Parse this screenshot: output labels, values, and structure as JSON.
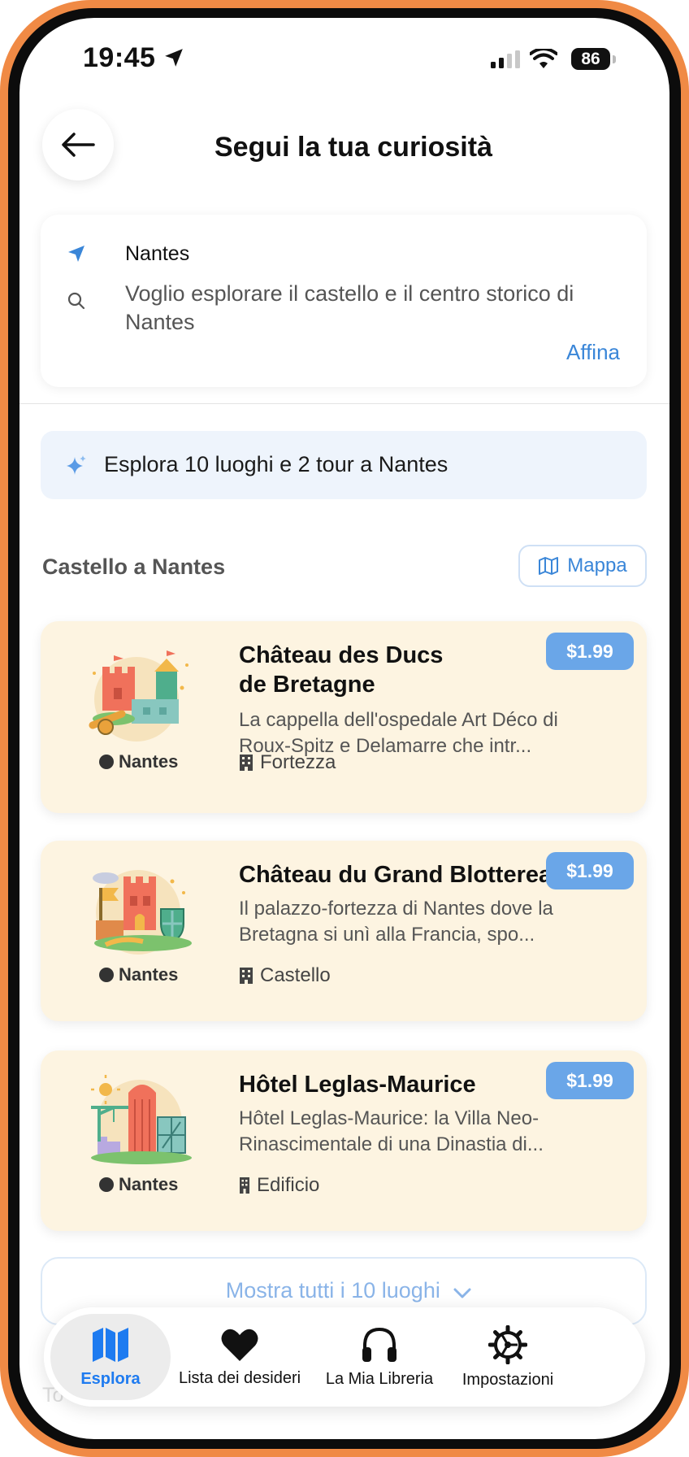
{
  "status_bar": {
    "time": "19:45",
    "battery": "86"
  },
  "header": {
    "title": "Segui la tua curiosità"
  },
  "search": {
    "location": "Nantes",
    "query": "Voglio esplorare il castello e il centro storico di Nantes",
    "refine_label": "Affina"
  },
  "banner": {
    "text": "Esplora 10 luoghi e 2 tour a Nantes"
  },
  "section": {
    "title": "Castello a Nantes",
    "map_label": "Mappa"
  },
  "places": [
    {
      "title": "Château des Ducs\nde Bretagne",
      "description": "La cappella dell'ospedale Art Déco di Roux-Spitz e Delamarre che intr...",
      "category": "Fortezza",
      "city": "Nantes",
      "price": "$1.99"
    },
    {
      "title": "Château du Grand Blottereau",
      "description": "Il palazzo-fortezza di Nantes dove la Bretagna si unì alla Francia, spo...",
      "category": "Castello",
      "city": "Nantes",
      "price": "$1.99"
    },
    {
      "title": "Hôtel Leglas-Maurice",
      "description": "Hôtel Leglas-Maurice: la Villa Neo-Rinascimentale di una Dinastia di...",
      "category": "Edificio",
      "city": "Nantes",
      "price": "$1.99"
    }
  ],
  "show_all_label": "Mostra tutti i 10 luoghi",
  "ghost_text": "To",
  "tabs": [
    {
      "label": "Esplora",
      "icon": "map-icon",
      "active": true
    },
    {
      "label": "Lista dei desideri",
      "icon": "heart-icon",
      "active": false
    },
    {
      "label": "La Mia Libreria",
      "icon": "headphones-icon",
      "active": false
    },
    {
      "label": "Impostazioni",
      "icon": "gear-icon",
      "active": false
    }
  ],
  "colors": {
    "accent": "#3a86d8",
    "card_bg": "#fdf4e1",
    "price_bg": "#6aa6e8",
    "frame": "#f08a45"
  }
}
